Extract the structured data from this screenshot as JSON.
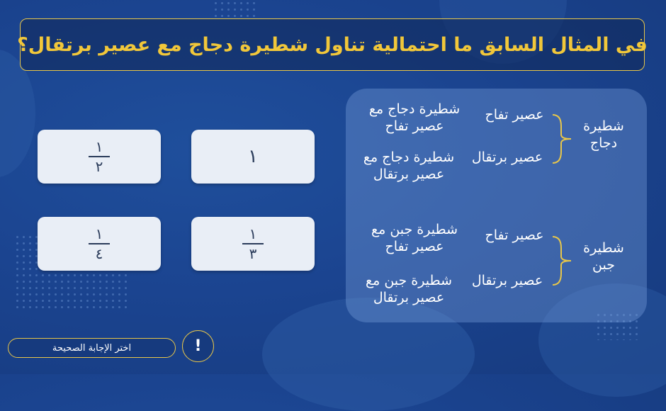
{
  "question": {
    "text": "في المثال السابق ما احتمالية تناول شطيرة دجاج مع عصير برتقال؟"
  },
  "answers": [
    {
      "kind": "whole",
      "value": "١"
    },
    {
      "kind": "fraction",
      "numerator": "١",
      "denominator": "٢"
    },
    {
      "kind": "fraction",
      "numerator": "١",
      "denominator": "٣"
    },
    {
      "kind": "fraction",
      "numerator": "١",
      "denominator": "٤"
    }
  ],
  "tree": {
    "branches": [
      {
        "root": "شطيرة دجاج",
        "juices": [
          "عصير تفاح",
          "عصير برتقال"
        ],
        "outcomes": [
          "شطيرة دجاج مع عصير تفاح",
          "شطيرة دجاج مع عصير برتقال"
        ]
      },
      {
        "root": "شطيرة جبن",
        "juices": [
          "عصير تفاح",
          "عصير برتقال"
        ],
        "outcomes": [
          "شطيرة جبن مع عصير تفاح",
          "شطيرة جبن مع عصير برتقال"
        ]
      }
    ]
  },
  "footer": {
    "instruction": "اختر الإجابة الصحيحة",
    "alert_symbol": "!"
  },
  "colors": {
    "accent": "#e7c64a",
    "question_text": "#f1c73a",
    "background": "#1b4490",
    "card": "#e9eef6"
  }
}
